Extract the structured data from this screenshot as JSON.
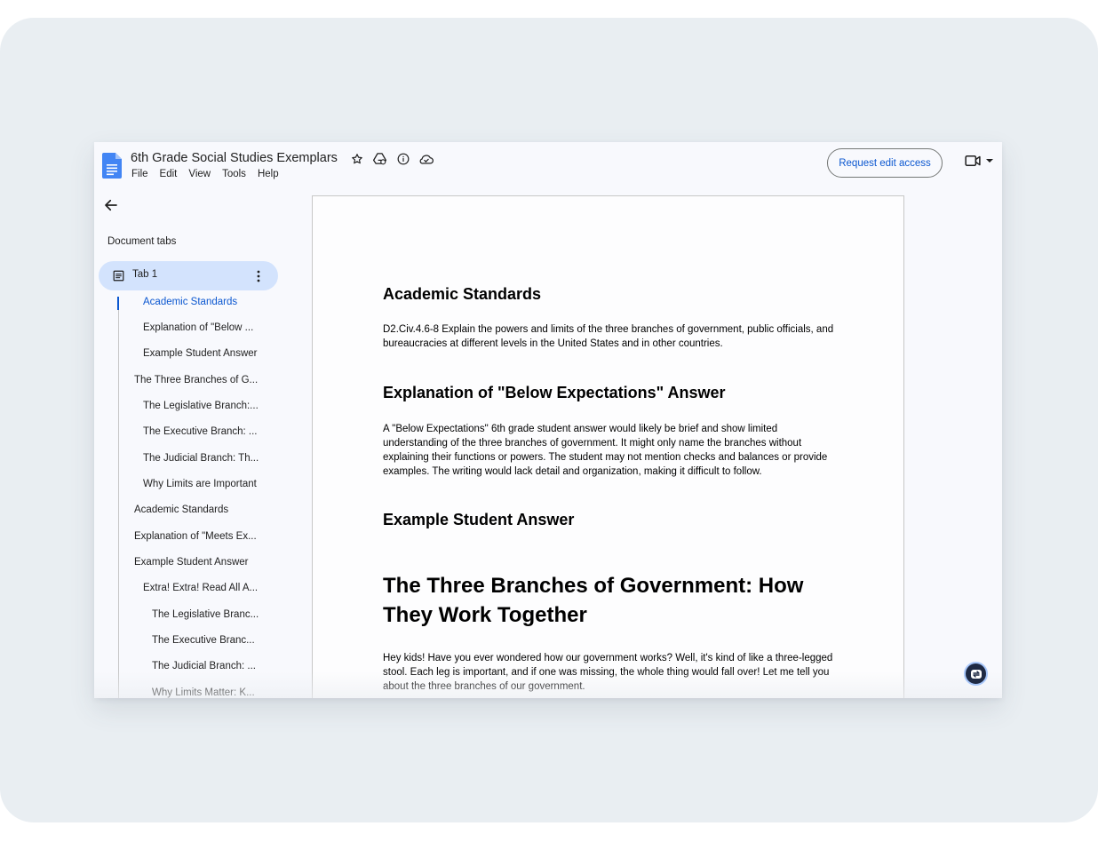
{
  "header": {
    "title": "6th Grade Social Studies Exemplars",
    "menu": [
      "File",
      "Edit",
      "View",
      "Tools",
      "Help"
    ],
    "request_button": "Request edit access",
    "title_icons": [
      "star-icon",
      "drive-move-icon",
      "info-icon",
      "cloud-status-icon"
    ],
    "meet_icon": "video-camera-icon"
  },
  "sidebar": {
    "heading": "Document tabs",
    "tab": {
      "label": "Tab 1"
    },
    "outline": [
      "Academic Standards",
      "Explanation of \"Below ...",
      "Example Student Answer",
      "The Three Branches of G...",
      "The Legislative Branch:...",
      "The Executive Branch: ...",
      "The Judicial Branch: Th...",
      "Why Limits are Important",
      "Academic Standards",
      "Explanation of \"Meets Ex...",
      "Example Student Answer",
      "Extra! Extra! Read All A...",
      "The Legislative Branc...",
      "The Executive Branc...",
      "The Judicial Branch: ...",
      "Why Limits Matter: K..."
    ]
  },
  "document": {
    "h_academic": "Academic Standards",
    "p_standard": "D2.Civ.4.6-8 Explain the powers and limits of the three branches of government, public officials, and bureaucracies at different levels in the United States and in other countries.",
    "h_explanation": "Explanation of \"Below Expectations\" Answer",
    "p_explanation": "A \"Below Expectations\" 6th grade student answer would likely be brief and show limited understanding of the three branches of government. It might only name the branches without explaining their functions or powers. The student may not mention checks and balances or provide examples. The writing would lack detail and organization, making it difficult to follow.",
    "h_example": "Example Student Answer",
    "h_title": "The Three Branches of Government: How They Work Together",
    "p_intro": "Hey kids! Have you ever wondered how our government works? Well, it's kind of like a three-legged stool. Each leg is important, and if one was missing, the whole thing would fall over! Let me tell you about the three branches of our government."
  },
  "colors": {
    "accent": "#0b57d0",
    "tab_pill": "#d3e3fd",
    "window_bg": "#f8f9fd",
    "outer_bg": "#e9eef2"
  }
}
